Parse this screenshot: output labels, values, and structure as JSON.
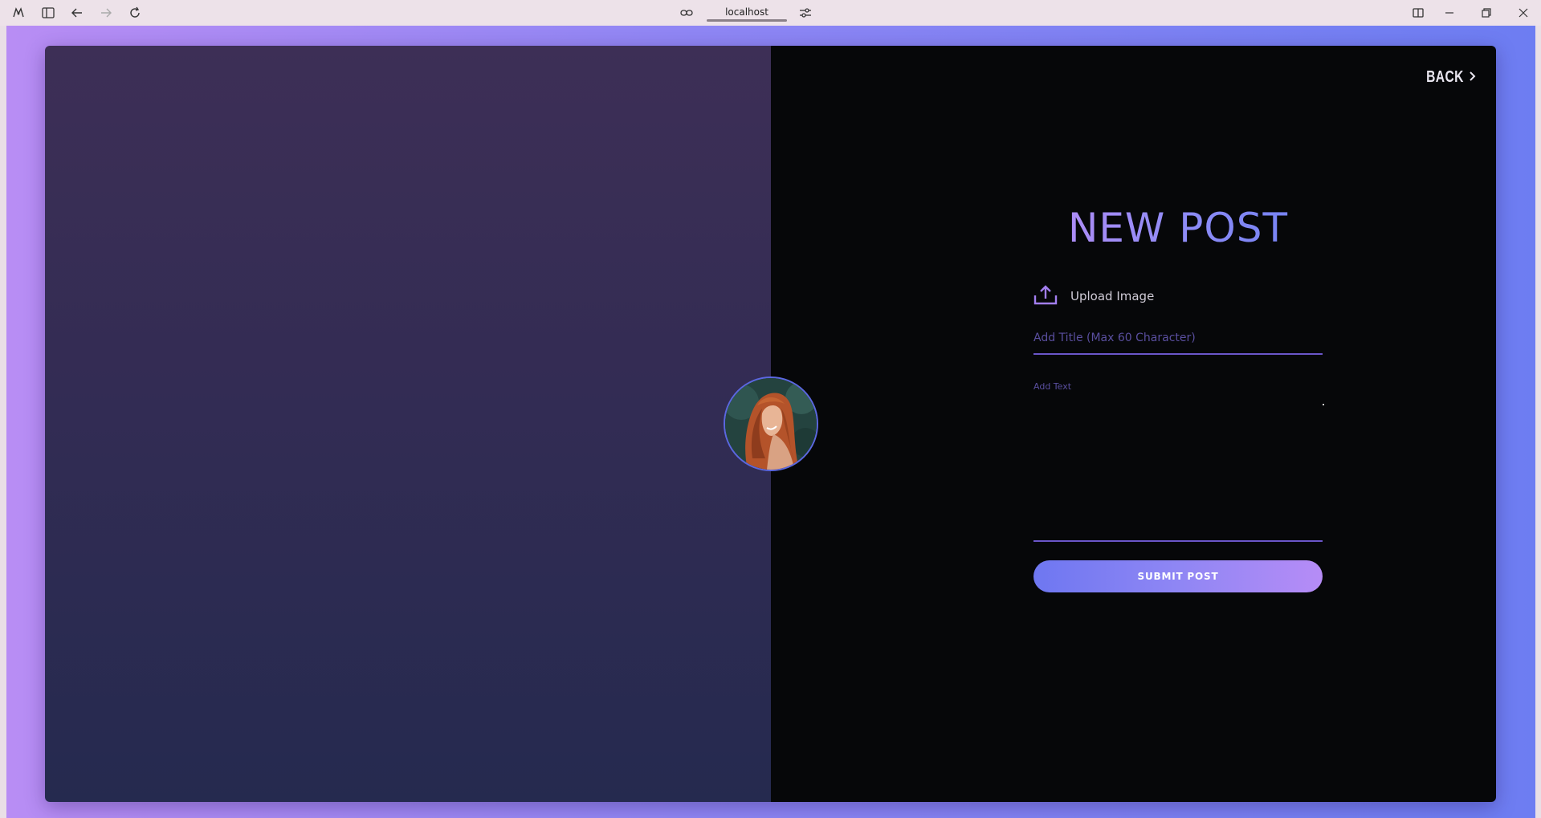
{
  "browser": {
    "url": "localhost",
    "icons": [
      "app-logo-icon",
      "sidebar-toggle-icon",
      "back-arrow-icon",
      "forward-arrow-icon",
      "reload-icon",
      "link-icon",
      "site-settings-icon",
      "split-view-icon",
      "minimize-icon",
      "maximize-icon",
      "close-icon"
    ]
  },
  "header": {
    "back_label": "BACK"
  },
  "form": {
    "title": "NEW POST",
    "upload_label": "Upload Image",
    "title_placeholder": "Add Title (Max 60 Character)",
    "title_value": "",
    "text_placeholder": "Add Text",
    "text_value": "",
    "submit_label": "SUBMIT POST"
  },
  "colors": {
    "accent_start": "#6e77f1",
    "accent_end": "#b68cf6",
    "panel_dark": "#060709",
    "panel_left_top": "#3d2f56",
    "panel_left_bottom": "#252a4f"
  }
}
